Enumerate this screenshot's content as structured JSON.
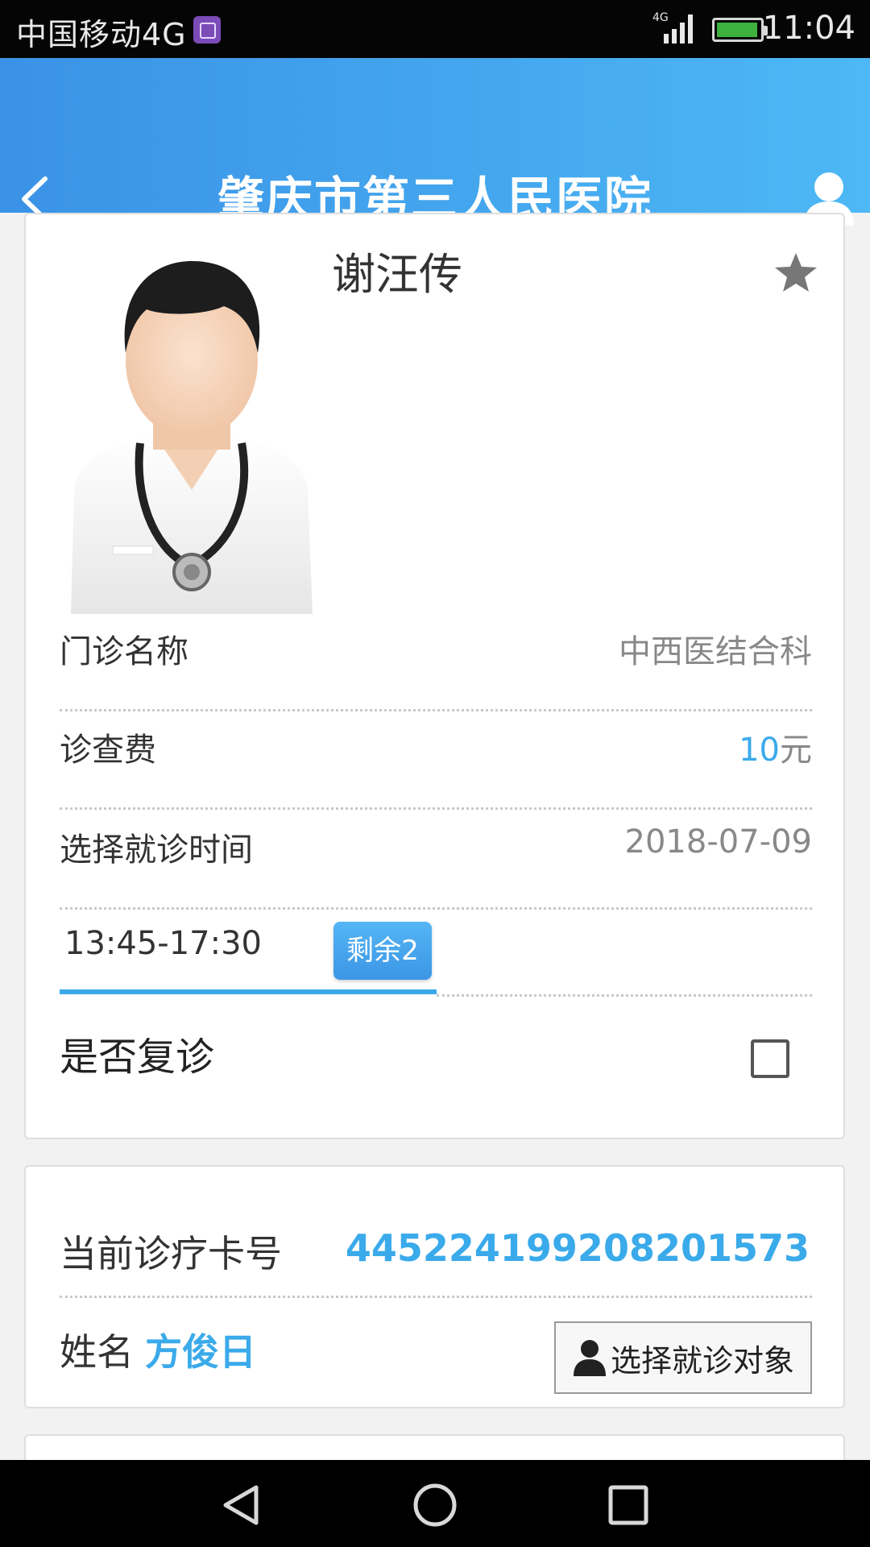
{
  "status_bar": {
    "carrier": "中国移动4G",
    "network": "4G",
    "time": "11:04"
  },
  "header": {
    "title": "肇庆市第三人民医院",
    "back_icon": "back-arrow-icon",
    "user_icon": "user-icon"
  },
  "doctor": {
    "name": "谢汪传",
    "favorite_icon": "star-icon"
  },
  "details": {
    "clinic_label": "门诊名称",
    "clinic_value": "中西医结合科",
    "fee_label": "诊查费",
    "fee_amount": "10",
    "fee_unit": "元",
    "time_label": "选择就诊时间",
    "date_value": "2018-07-09",
    "timeslot": "13:45-17:30",
    "remaining": "剩余2",
    "revisit_label": "是否复诊",
    "revisit_checked": false
  },
  "patient": {
    "card_label": "当前诊疗卡号",
    "card_number": "445224199208201573",
    "name_label": "姓名",
    "name_value": "方俊日",
    "select_button": "选择就诊对象"
  },
  "colors": {
    "accent": "#3aaaea",
    "header_start": "#3a92e6",
    "header_end": "#4db8f5"
  }
}
